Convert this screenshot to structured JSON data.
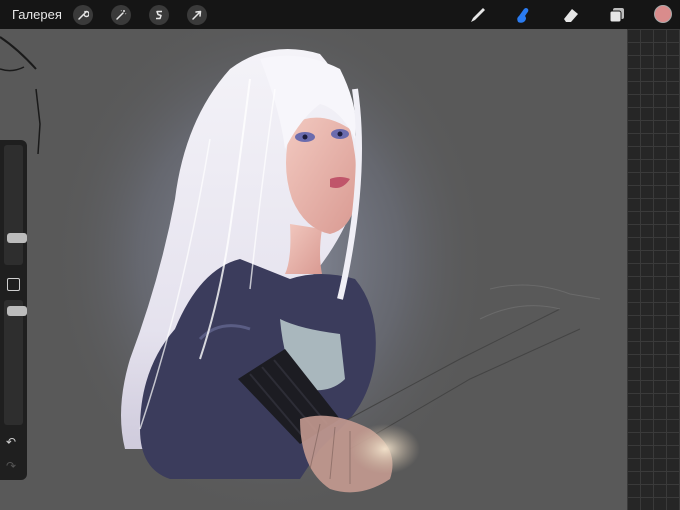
{
  "topbar": {
    "gallery_label": "Галерея",
    "left_tools": [
      {
        "name": "actions",
        "icon": "wrench-icon"
      },
      {
        "name": "adjustments",
        "icon": "magic-wand-icon"
      },
      {
        "name": "selection",
        "icon": "selection-s-icon"
      },
      {
        "name": "transform",
        "icon": "arrow-cursor-icon"
      }
    ],
    "right_tools": [
      {
        "name": "brush",
        "icon": "brush-icon",
        "active": false
      },
      {
        "name": "smudge",
        "icon": "smudge-finger-icon",
        "active": true
      },
      {
        "name": "eraser",
        "icon": "eraser-icon",
        "active": false
      },
      {
        "name": "layers",
        "icon": "layers-icon",
        "active": false
      }
    ],
    "current_color": "#d98c8c",
    "active_tool_color": "#2a7bf0"
  },
  "sidebar": {
    "brush_size_level": 0.2,
    "opacity_level": 0.95,
    "icons": [
      "modify-square-icon",
      "undo-icon",
      "redo-icon"
    ]
  },
  "canvas": {
    "background": "#595959",
    "reference_panel": "grid"
  }
}
